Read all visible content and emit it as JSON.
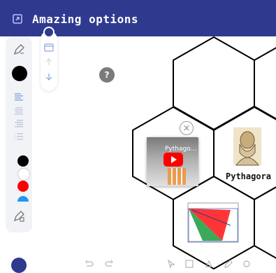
{
  "header": {
    "title": "Amazing options"
  },
  "help": {
    "label": "?"
  },
  "video": {
    "title": "Pythago..."
  },
  "tiles": {
    "pythagoras_label": "Pythagora"
  },
  "palette": {
    "accent": "#2f3a8f",
    "colors": [
      "#000000",
      "#ffffff",
      "#ff0000",
      "#2196f3"
    ]
  },
  "icons": {
    "header": [
      "expand-icon"
    ],
    "left_panel": [
      "pen-icon",
      "brush-size-icon",
      "text-lines-icon",
      "color-dot",
      "eraser-icon"
    ],
    "bottom": [
      "home-icon",
      "undo-icon",
      "redo-icon",
      "pointer-icon",
      "image-icon",
      "shape-icon",
      "pen-icon",
      "tool-icon"
    ]
  }
}
